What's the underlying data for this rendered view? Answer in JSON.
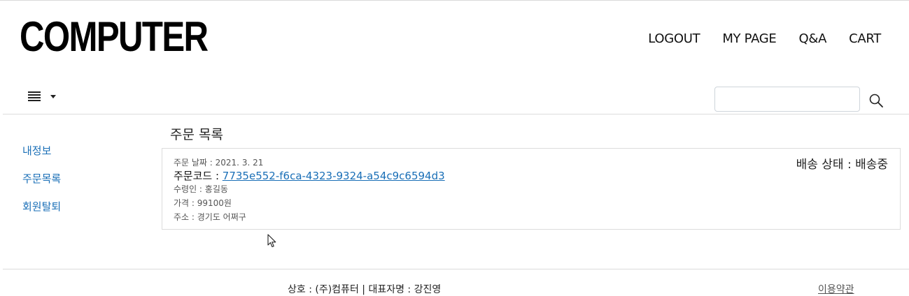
{
  "header": {
    "logo": "COMPUTER",
    "nav": [
      "LOGOUT",
      "MY PAGE",
      "Q&A",
      "CART"
    ]
  },
  "search": {
    "value": "",
    "placeholder": ""
  },
  "sidebar": {
    "items": [
      "내정보",
      "주문목록",
      "회원탈퇴"
    ]
  },
  "main": {
    "title": "주문 목록",
    "order": {
      "date": "주문 날짜 : 2021. 3. 21",
      "code_label": "주문코드 : ",
      "code": "7735e552-f6ca-4323-9324-a54c9c6594d3",
      "recipient": "수령인 : 홍길동",
      "price": "가격 : 99100원",
      "address": "주소 : 경기도 어쩌구",
      "status": "배송 상태 : 배송중"
    }
  },
  "footer": {
    "company": "상호 : (주)컴퓨터 | 대표자명 : 강진영",
    "terms": "이용약관"
  },
  "colors": {
    "link": "#1a6fb7",
    "border": "#dcdcdc"
  }
}
